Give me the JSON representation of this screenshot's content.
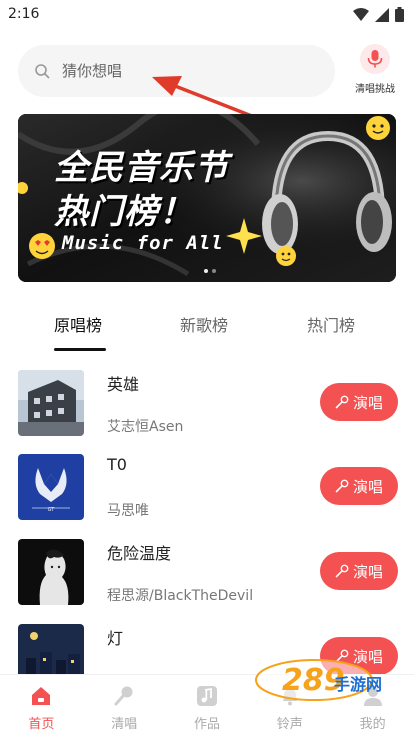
{
  "status_bar": {
    "time": "2:16"
  },
  "search": {
    "placeholder": "猜你想唱"
  },
  "challenge": {
    "label": "清唱挑战"
  },
  "banner": {
    "title_line1": "全民音乐节",
    "title_line2": "热门榜！",
    "subtitle": "Music for All",
    "page_count": 2,
    "active_page": 1
  },
  "tabs": [
    {
      "label": "原唱榜",
      "active": true
    },
    {
      "label": "新歌榜",
      "active": false
    },
    {
      "label": "热门榜",
      "active": false
    }
  ],
  "songs": [
    {
      "title": "英雄",
      "artist": "艾志恒Asen",
      "button": "演唱"
    },
    {
      "title": "T0",
      "artist": "马思唯",
      "button": "演唱"
    },
    {
      "title": "危险温度",
      "artist": "程思源/BlackTheDevil",
      "button": "演唱"
    },
    {
      "title": "灯",
      "artist": "",
      "button": "演唱"
    }
  ],
  "bottom_nav": [
    {
      "label": "首页",
      "icon": "home-icon",
      "active": true
    },
    {
      "label": "清唱",
      "icon": "microphone-icon",
      "active": false
    },
    {
      "label": "作品",
      "icon": "music-note-icon",
      "active": false
    },
    {
      "label": "铃声",
      "icon": "bell-icon",
      "active": false
    },
    {
      "label": "我的",
      "icon": "profile-icon",
      "active": false
    }
  ],
  "watermark": {
    "text": "289",
    "subtext": "手游网"
  },
  "colors": {
    "accent": "#f35152",
    "text_primary": "#222222",
    "text_secondary": "#777777"
  }
}
